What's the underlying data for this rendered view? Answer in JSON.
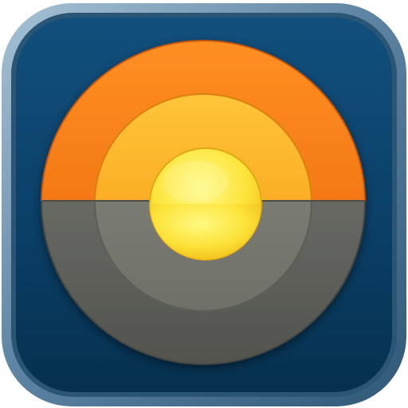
{
  "app_icon": {
    "colors": {
      "tile_outer_highlight": "#7fa2bb",
      "tile_face_light": "#0f4b78",
      "tile_face_dark": "#073154",
      "outer_ring_light": "#ff8a1a",
      "outer_ring_dark": "#e96508",
      "middle_ring_light": "#ffc036",
      "middle_ring_dark": "#f79a12",
      "sun_light": "#fff56a",
      "sun_dark": "#f3c21a",
      "ground_outer_light": "#7a7b76",
      "ground_outer_dark": "#565752",
      "ground_middle": "#7c7d73",
      "sun_lower": "#c9c16f"
    }
  }
}
